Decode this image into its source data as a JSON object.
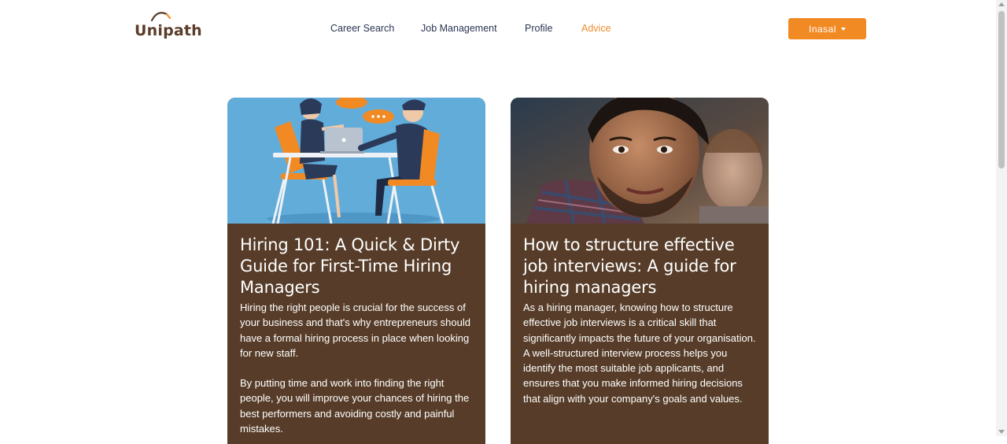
{
  "header": {
    "logo_text": "Unipath",
    "nav": [
      {
        "label": "Career Search",
        "active": false
      },
      {
        "label": "Job Management",
        "active": false
      },
      {
        "label": "Profile",
        "active": false
      },
      {
        "label": "Advice",
        "active": true
      }
    ],
    "user_button_label": "Inasal"
  },
  "cards": [
    {
      "title": "Hiring 101: A Quick & Dirty Guide for First-Time Hiring Managers",
      "paragraphs": [
        "Hiring the right people is crucial for the success of your business and that's why entrepreneurs should have a formal hiring process in place when looking for new staff.",
        "By putting time and work into finding the right people, you will improve your chances of hiring the best performers and avoiding costly and painful mistakes."
      ],
      "image": "illustration-interview-icon"
    },
    {
      "title": "How to structure effective job interviews: A guide for hiring managers",
      "paragraphs": [
        "As a hiring manager, knowing how to structure effective job interviews is a critical skill that significantly impacts the future of your organisation. A well-structured interview process helps you identify the most suitable job applicants, and ensures that you make informed hiring decisions that align with your company's goals and values."
      ],
      "image": "smiling-man-photo"
    }
  ],
  "colors": {
    "brand_brown": "#573d29",
    "accent_orange": "#f28a24",
    "nav_text": "#2a3552"
  }
}
